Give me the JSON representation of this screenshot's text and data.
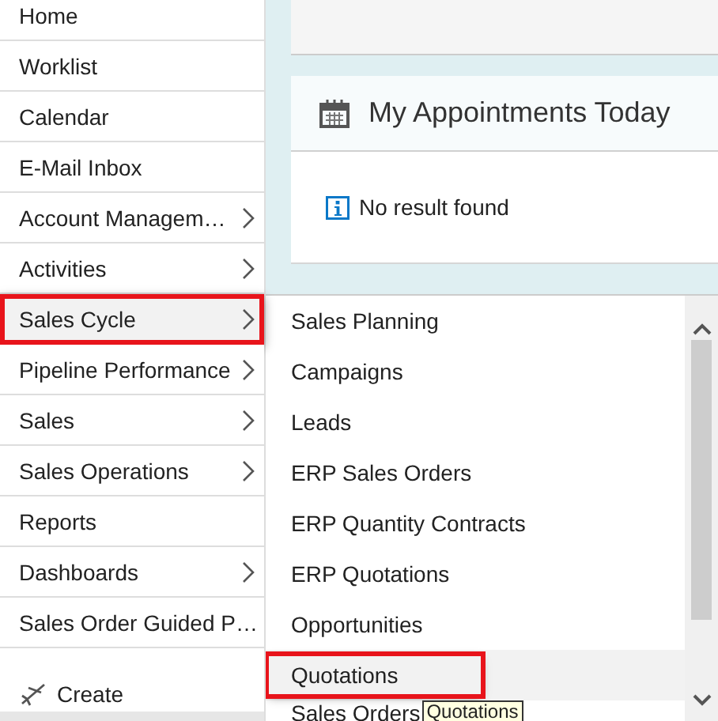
{
  "nav": {
    "items": [
      {
        "label": "Home",
        "has_children": false,
        "selected": false
      },
      {
        "label": "Worklist",
        "has_children": false,
        "selected": false
      },
      {
        "label": "Calendar",
        "has_children": false,
        "selected": false
      },
      {
        "label": "E-Mail Inbox",
        "has_children": false,
        "selected": false
      },
      {
        "label": "Account Managem…",
        "has_children": true,
        "selected": false
      },
      {
        "label": "Activities",
        "has_children": true,
        "selected": false
      },
      {
        "label": "Sales Cycle",
        "has_children": true,
        "selected": true
      },
      {
        "label": "Pipeline Performance",
        "has_children": true,
        "selected": false
      },
      {
        "label": "Sales",
        "has_children": true,
        "selected": false
      },
      {
        "label": "Sales Operations",
        "has_children": true,
        "selected": false
      },
      {
        "label": "Reports",
        "has_children": false,
        "selected": false
      },
      {
        "label": "Dashboards",
        "has_children": true,
        "selected": false
      },
      {
        "label": "Sales Order Guided P…",
        "has_children": false,
        "selected": false
      }
    ],
    "create": "Create"
  },
  "appointments": {
    "title": "My Appointments Today",
    "message": "No result found"
  },
  "submenu": {
    "items": [
      {
        "label": "Sales Planning",
        "selected": false
      },
      {
        "label": "Campaigns",
        "selected": false
      },
      {
        "label": "Leads",
        "selected": false
      },
      {
        "label": "ERP Sales Orders",
        "selected": false
      },
      {
        "label": "ERP Quantity Contracts",
        "selected": false
      },
      {
        "label": "ERP Quotations",
        "selected": false
      },
      {
        "label": "Opportunities",
        "selected": false
      },
      {
        "label": "Quotations",
        "selected": true
      },
      {
        "label": "Sales Orders",
        "selected": false
      }
    ],
    "tooltip": "Quotations"
  }
}
